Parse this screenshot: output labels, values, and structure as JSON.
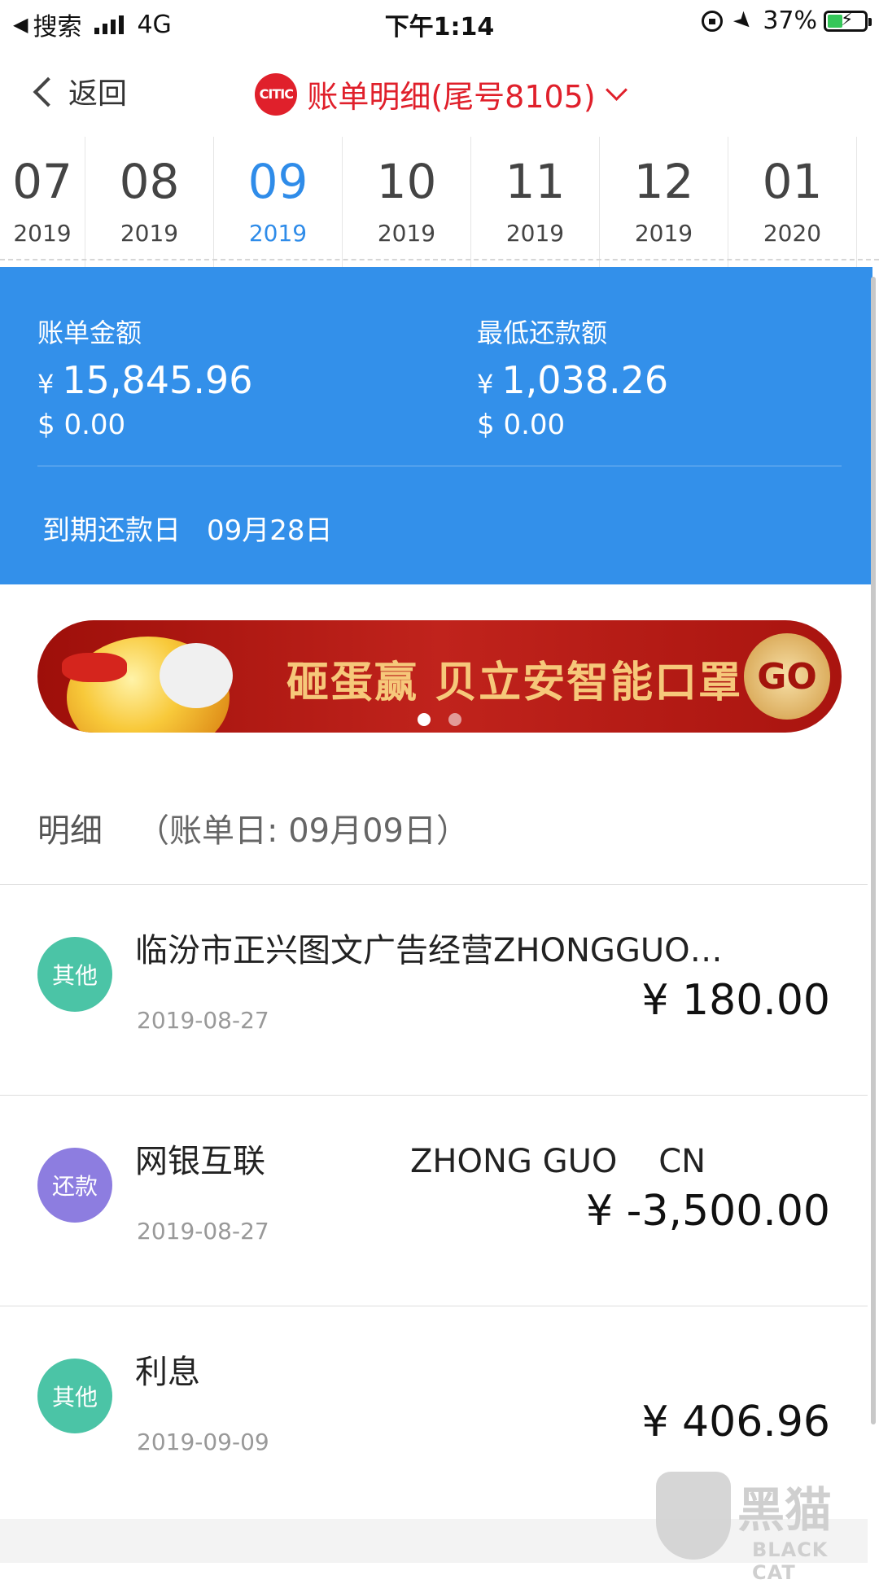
{
  "status_bar": {
    "back_app": "搜索",
    "network": "4G",
    "time": "下午1:14",
    "battery": "37%"
  },
  "nav": {
    "back_label": "返回",
    "logo_text": "CITIC",
    "title": "账单明细(尾号8105)"
  },
  "month_tabs": [
    {
      "month": "07",
      "year": "2019",
      "active": false
    },
    {
      "month": "08",
      "year": "2019",
      "active": false
    },
    {
      "month": "09",
      "year": "2019",
      "active": true
    },
    {
      "month": "10",
      "year": "2019",
      "active": false
    },
    {
      "month": "11",
      "year": "2019",
      "active": false
    },
    {
      "month": "12",
      "year": "2019",
      "active": false
    },
    {
      "month": "01",
      "year": "2020",
      "active": false
    }
  ],
  "summary": {
    "bill_label": "账单金额",
    "bill_currency": "¥",
    "bill_amount": "15,845.96",
    "bill_usd": "$ 0.00",
    "min_label": "最低还款额",
    "min_currency": "¥",
    "min_amount": "1,038.26",
    "min_usd": "$ 0.00",
    "due_label": "到期还款日",
    "due_date": "09月28日"
  },
  "banner": {
    "text": "砸蛋赢 贝立安智能口罩",
    "go": "GO",
    "slides": 2,
    "active_slide": 1
  },
  "details": {
    "title": "明细",
    "bill_day": "（账单日: 09月09日）"
  },
  "transactions": [
    {
      "badge": "其他",
      "badge_color": "#4bc4a6",
      "desc": "临汾市正兴图文广告经营ZHONGGUO…",
      "date": "2019-08-27",
      "amount": "¥ 180.00"
    },
    {
      "badge": "还款",
      "badge_color": "#8d7de0",
      "desc": "网银互联              ZHONG GUO    CN",
      "date": "2019-08-27",
      "amount": "¥ -3,500.00"
    },
    {
      "badge": "其他",
      "badge_color": "#4bc4a6",
      "desc": "利息",
      "date": "2019-09-09",
      "amount": "¥ 406.96"
    }
  ],
  "watermark": {
    "text": "黑猫",
    "sub": "BLACK CAT"
  },
  "colors": {
    "accent": "#2f8ce9",
    "summary_bg": "#3390ea",
    "brand_red": "#e0202b"
  }
}
